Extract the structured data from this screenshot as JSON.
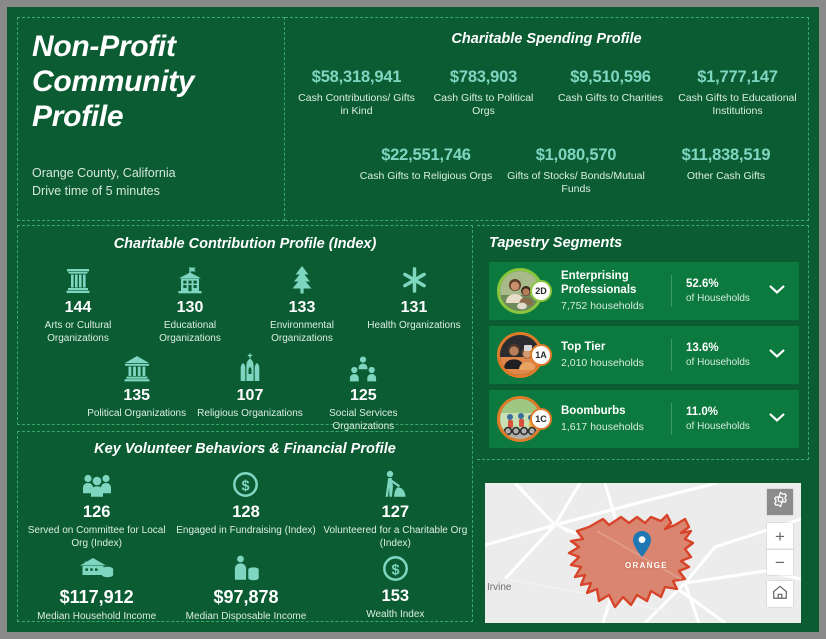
{
  "header": {
    "title": "Non-Profit Community Profile",
    "location": "Orange County, California",
    "drive_time": "Drive time of 5 minutes"
  },
  "spending": {
    "title": "Charitable Spending Profile",
    "row1": [
      {
        "value": "$58,318,941",
        "label": "Cash Contributions/ Gifts in Kind"
      },
      {
        "value": "$783,903",
        "label": "Cash Gifts to Political Orgs"
      },
      {
        "value": "$9,510,596",
        "label": "Cash Gifts to Charities"
      },
      {
        "value": "$1,777,147",
        "label": "Cash Gifts to Educational Institutions"
      }
    ],
    "row2": [
      {
        "value": "$22,551,746",
        "label": "Cash Gifts to Religious Orgs"
      },
      {
        "value": "$1,080,570",
        "label": "Gifts of Stocks/ Bonds/Mutual Funds"
      },
      {
        "value": "$11,838,519",
        "label": "Other Cash Gifts"
      }
    ]
  },
  "contribution": {
    "title": "Charitable Contribution Profile (Index)",
    "row1": [
      {
        "icon": "museum-icon",
        "value": "144",
        "label": "Arts or Cultural Organizations"
      },
      {
        "icon": "school-icon",
        "value": "130",
        "label": "Educational Organizations"
      },
      {
        "icon": "tree-icon",
        "value": "133",
        "label": "Environmental Organizations"
      },
      {
        "icon": "health-asterisk-icon",
        "value": "131",
        "label": "Health Organizations"
      }
    ],
    "row2": [
      {
        "icon": "bank-icon",
        "value": "135",
        "label": "Political Organizations"
      },
      {
        "icon": "church-icon",
        "value": "107",
        "label": "Religious Organizations"
      },
      {
        "icon": "people-group-icon",
        "value": "125",
        "label": "Social Services Organizations"
      }
    ]
  },
  "volunteer": {
    "title": "Key Volunteer Behaviors & Financial Profile",
    "row1": [
      {
        "icon": "three-people-icon",
        "value": "126",
        "label": "Served on Committee for Local Org (Index)"
      },
      {
        "icon": "dollar-circle-icon",
        "value": "128",
        "label": "Engaged in Fundraising (Index)"
      },
      {
        "icon": "volunteer-raking-icon",
        "value": "127",
        "label": "Volunteered for a Charitable Org (Index)"
      }
    ],
    "row2": [
      {
        "icon": "house-coins-icon",
        "value": "$117,912",
        "label": "Median Household Income"
      },
      {
        "icon": "person-coins-icon",
        "value": "$97,878",
        "label": "Median Disposable Income"
      },
      {
        "icon": "dollar-circle-icon",
        "value": "153",
        "label": "Wealth Index"
      }
    ]
  },
  "tapestry": {
    "title": "Tapestry Segments",
    "pct_sublabel": "of Households",
    "segments": [
      {
        "code": "2D",
        "name": "Enterprising Professionals",
        "households": "7,752 households",
        "pct": "52.6%",
        "ring": "green"
      },
      {
        "code": "1A",
        "name": "Top Tier",
        "households": "2,010 households",
        "pct": "13.6%",
        "ring": "orange"
      },
      {
        "code": "1C",
        "name": "Boomburbs",
        "households": "1,617 households",
        "pct": "11.0%",
        "ring": "orange"
      }
    ]
  },
  "map": {
    "area_label": "ORANGE",
    "nearby_label": "Irvine",
    "controls": {
      "gear": "gear-icon",
      "zoom_in": "+",
      "zoom_out": "−",
      "home": "home-icon"
    }
  },
  "colors": {
    "background": "#0b5c33",
    "accent_teal": "#7fd6c0",
    "row_green": "#0c7a3e",
    "dash_border": "#3aa86a",
    "badge_orange": "#e07b2a",
    "badge_green": "#8cc63f",
    "map_area": "#d98570",
    "map_area_stroke": "#d8442a",
    "pin_blue": "#1f78b4"
  }
}
